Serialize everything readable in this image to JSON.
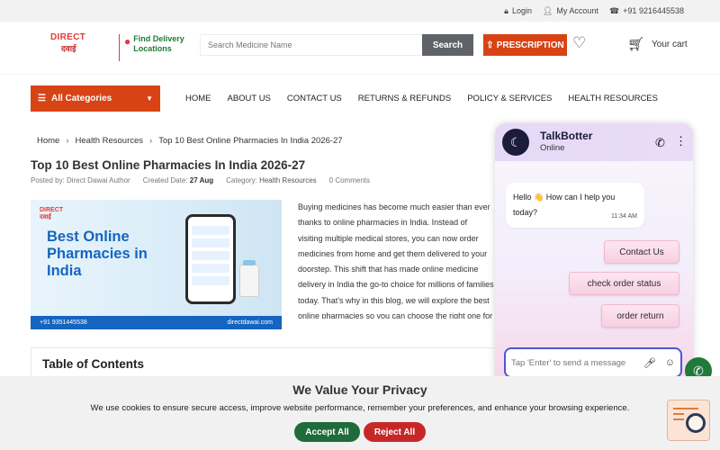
{
  "topbar": {
    "login": "Login",
    "account": "My Account",
    "phone": "+91 9216445538"
  },
  "header": {
    "logo_top": "DIRECT",
    "logo_bottom": "दवाई",
    "delivery_line1": "Find Delivery",
    "delivery_line2": "Locations",
    "search_placeholder": "Search Medicine Name",
    "search_button": "Search",
    "prescription_button": "PRESCRIPTION",
    "cart_label": "Your cart"
  },
  "nav": {
    "all_categories": "All Categories",
    "links": [
      "HOME",
      "ABOUT US",
      "CONTACT US",
      "RETURNS & REFUNDS",
      "POLICY & SERVICES",
      "HEALTH RESOURCES"
    ]
  },
  "breadcrumb": [
    "Home",
    "Health Resources",
    "Top 10 Best Online Pharmacies In India 2026-27"
  ],
  "article": {
    "title": "Top 10 Best Online Pharmacies In India 2026-27",
    "posted_by": "Posted by: Direct Dawai Author",
    "created_label": "Created Date:",
    "created_value": "27 Aug",
    "category_label": "Category:",
    "category_value": "Health Resources",
    "comments": "0 Comments",
    "hero": {
      "logo_top": "DIRECT",
      "logo_bottom": "दवाई",
      "title": "Best Online Pharmacies in India",
      "phone": "+91 9351445538",
      "website": "directdawai.com"
    },
    "intro": "Buying medicines has become much easier than ever thanks to online pharmacies in India. Instead of visiting multiple medical stores, you can now order medicines from home and get them delivered to your doorstep. This shift that has made online medicine delivery in India the go-to choice for millions of families today. That’s why in this blog, we will explore the best online pharmacies so you can choose the right one for your needs.",
    "toc_title": "Table of Contents"
  },
  "chat": {
    "bot_name": "TalkBotter",
    "status": "Online",
    "greeting": "Hello 👋 How can I help you today?",
    "greeting_time": "11:34 AM",
    "quick_replies": [
      "Contact Us",
      "check order status",
      "order return"
    ],
    "input_placeholder": "Tap 'Enter' to send a message"
  },
  "privacy": {
    "title": "We Value Your Privacy",
    "text": "We use cookies to ensure secure access, improve website performance, remember your preferences, and enhance your browsing experience.",
    "accept": "Accept All",
    "reject": "Reject All"
  },
  "icons": {
    "lock": "lock-icon",
    "user": "user-icon",
    "phone": "phone-icon",
    "pin": "location-pin-icon",
    "upload": "upload-icon",
    "heart": "heart-icon",
    "cart": "cart-icon",
    "menu": "menu-icon",
    "whatsapp": "whatsapp-icon",
    "mic": "mic-icon",
    "emoji": "emoji-icon",
    "support": "support-search-icon"
  },
  "colors": {
    "brand_red": "#d84315",
    "green": "#1f6b3a",
    "blue": "#1565c0",
    "reject_red": "#c62828"
  }
}
